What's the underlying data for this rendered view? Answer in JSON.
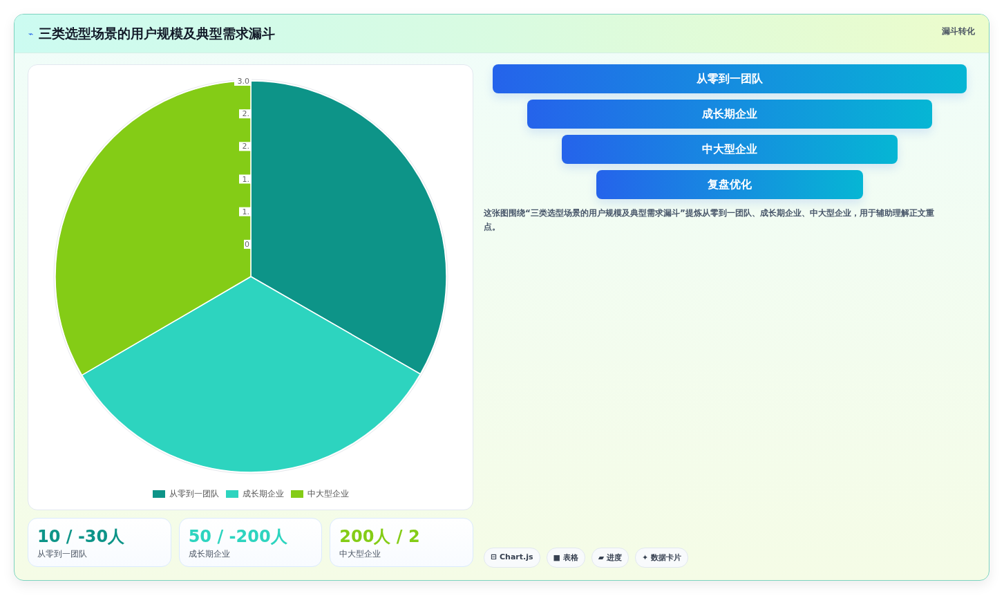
{
  "header": {
    "icon": "⌁",
    "title": "三类选型场景的用户规模及典型需求漏斗",
    "tag": "漏斗转化"
  },
  "chart": {
    "chart_data": {
      "type": "pie",
      "categories": [
        "从零到一团队",
        "成长期企业",
        "中大型企业"
      ],
      "values": [
        33.3,
        33.3,
        33.4
      ],
      "colors": [
        "#0d9488",
        "#2dd4bf",
        "#84cc16"
      ],
      "annotations": [
        "3.0",
        "2.",
        "2.",
        "1.",
        "1.",
        "0"
      ]
    }
  },
  "stats": [
    {
      "value": "10 / -30人",
      "label": "从零到一团队",
      "color": "#0d9488"
    },
    {
      "value": "50 / -200人",
      "label": "成长期企业",
      "color": "#2dd4bf"
    },
    {
      "value": "200人 / 2",
      "label": "中大型企业",
      "color": "#84cc16"
    }
  ],
  "funnel": [
    {
      "label": "从零到一团队"
    },
    {
      "label": "成长期企业"
    },
    {
      "label": "中大型企业"
    },
    {
      "label": "复盘优化"
    }
  ],
  "description": "这张图围绕“三类选型场景的用户规模及典型需求漏斗”提炼从零到一团队、成长期企业、中大型企业，用于辅助理解正文重点。",
  "chips": [
    {
      "icon": "⊟",
      "label": "Chart.js"
    },
    {
      "icon": "■",
      "label": "表格"
    },
    {
      "icon": "▰",
      "label": "进度"
    },
    {
      "icon": "✦",
      "label": "数据卡片"
    }
  ]
}
